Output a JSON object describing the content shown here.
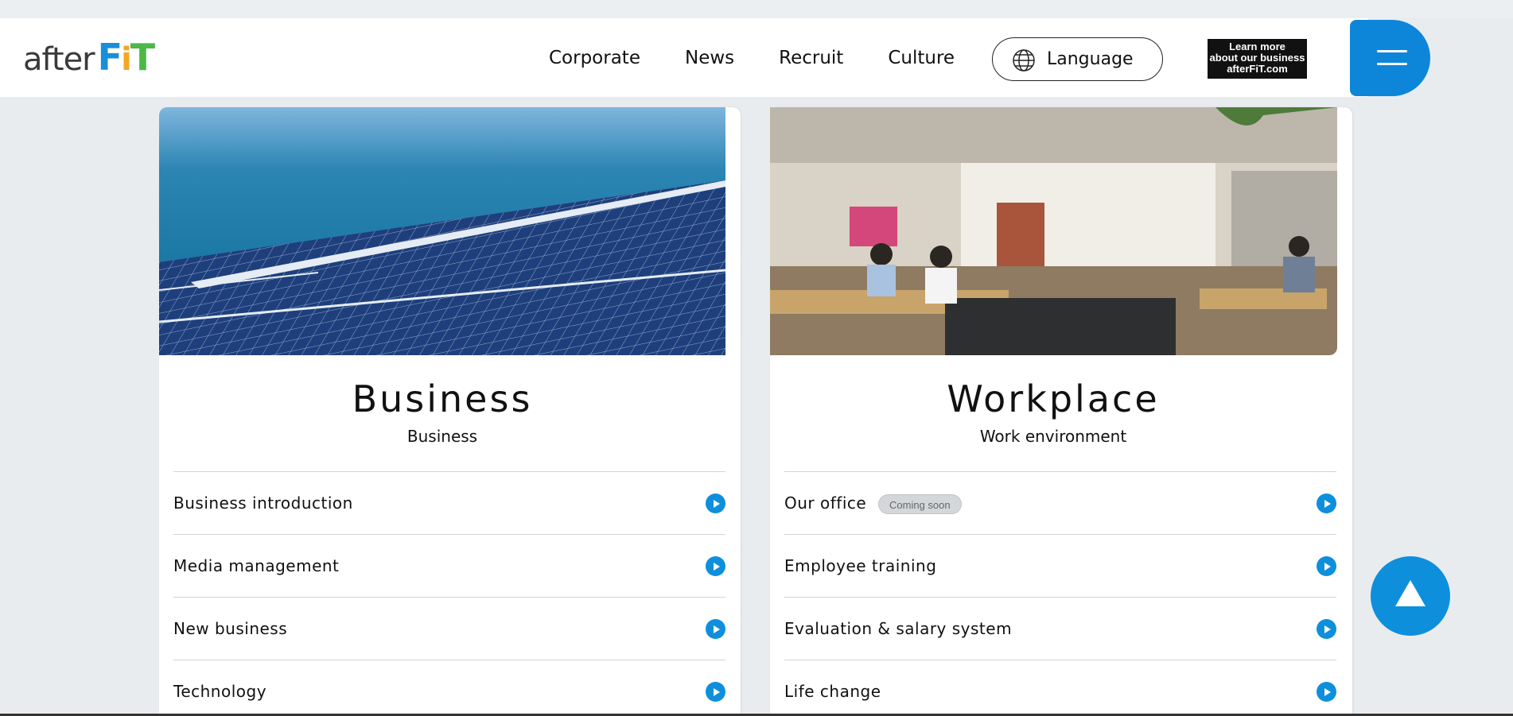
{
  "header": {
    "logo": {
      "after": "after",
      "fit_parts": [
        "F",
        "i",
        "T"
      ],
      "fit_colors": [
        "#1a8fd8",
        "#f5a623",
        "#4cb848"
      ]
    },
    "nav": [
      {
        "label": "Corporate"
      },
      {
        "label": "News"
      },
      {
        "label": "Recruit"
      },
      {
        "label": "Culture"
      }
    ],
    "language_label": "Language",
    "learn_more": {
      "line1": "Learn more",
      "line2": "about our business",
      "line3": "afterFiT.com"
    },
    "menu_icon": "hamburger-icon"
  },
  "cards": [
    {
      "title": "Business",
      "subtitle": "Business",
      "items": [
        {
          "label": "Business introduction"
        },
        {
          "label": "Media management"
        },
        {
          "label": "New business"
        },
        {
          "label": "Technology"
        }
      ]
    },
    {
      "title": "Workplace",
      "subtitle": "Work environment",
      "items": [
        {
          "label": "Our office",
          "badge": "Coming soon"
        },
        {
          "label": "Employee training"
        },
        {
          "label": "Evaluation & salary system"
        },
        {
          "label": "Life change"
        }
      ]
    }
  ],
  "colors": {
    "accent": "#0e8fdc",
    "background": "#e8ecef"
  },
  "scroll_top_icon": "triangle-up-icon"
}
